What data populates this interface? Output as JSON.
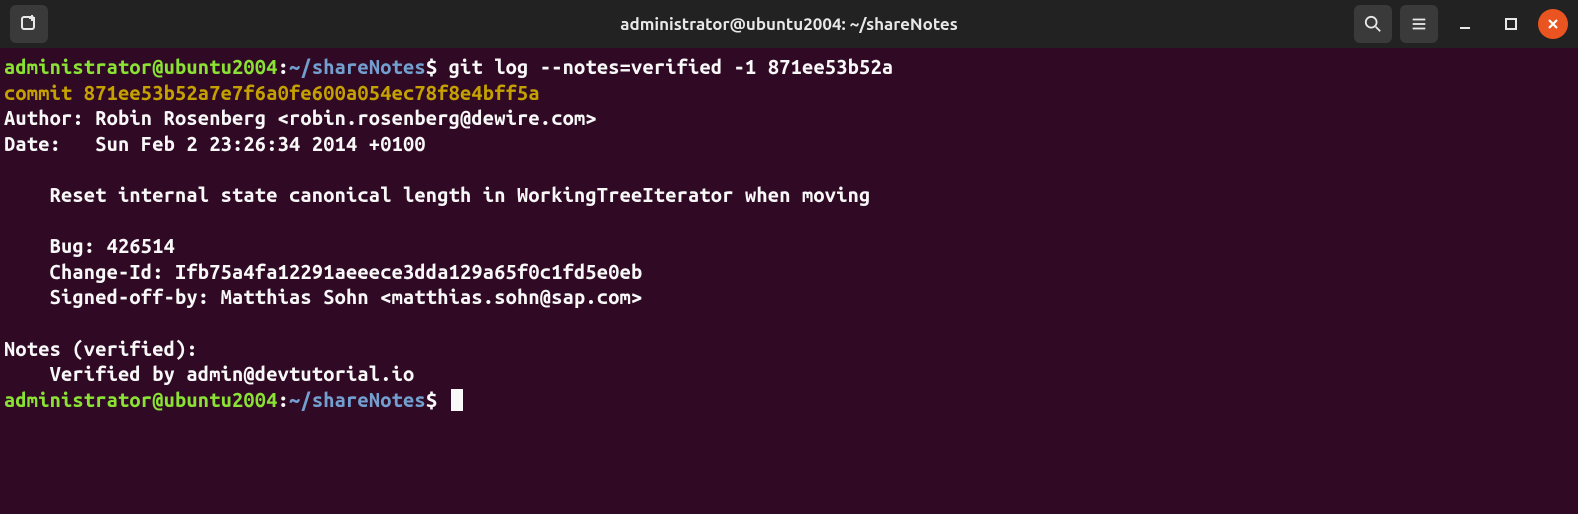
{
  "window": {
    "title": "administrator@ubuntu2004: ~/shareNotes"
  },
  "prompt": {
    "user_host": "administrator@ubuntu2004",
    "sep": ":",
    "path": "~/shareNotes",
    "symbol": "$"
  },
  "command": "git log --notes=verified -1 871ee53b52a",
  "output": {
    "commit_line": "commit 871ee53b52a7e7f6a0fe600a054ec78f8e4bff5a",
    "author_line": "Author: Robin Rosenberg <robin.rosenberg@dewire.com>",
    "date_line": "Date:   Sun Feb 2 23:26:34 2014 +0100",
    "msg_line1": "    Reset internal state canonical length in WorkingTreeIterator when moving",
    "msg_bug": "    Bug: 426514",
    "msg_changeid": "    Change-Id: Ifb75a4fa12291aeeece3dda129a65f0c1fd5e0eb",
    "msg_signedoff": "    Signed-off-by: Matthias Sohn <matthias.sohn@sap.com>",
    "notes_header": "Notes (verified):",
    "notes_body": "    Verified by admin@devtutorial.io"
  }
}
